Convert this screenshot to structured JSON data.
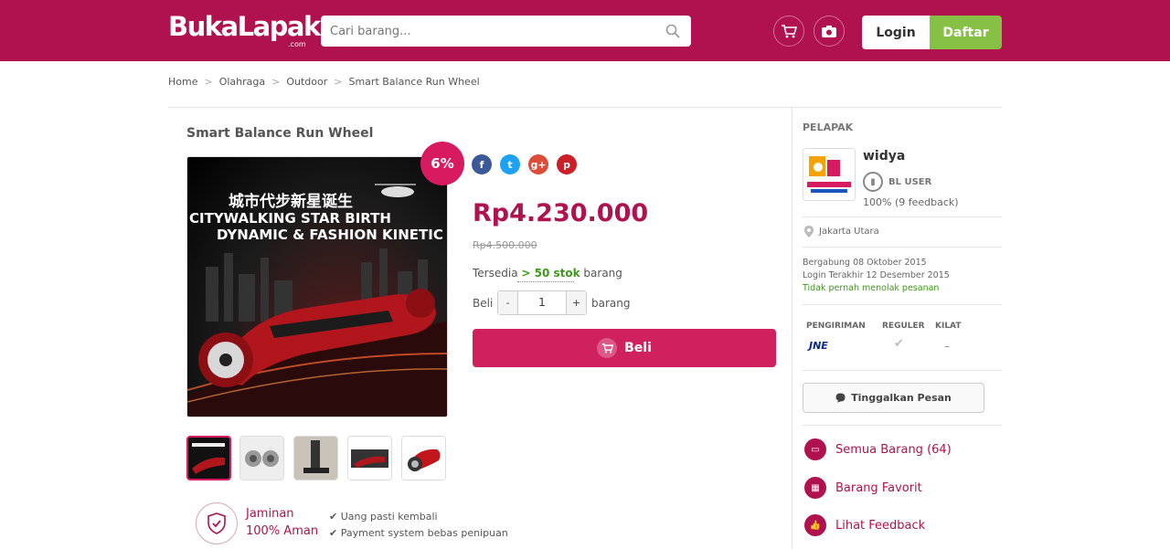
{
  "header": {
    "logo": "BukaLapak",
    "logo_sub": ".com",
    "search_placeholder": "Cari barang...",
    "login_label": "Login",
    "register_label": "Daftar",
    "icons": [
      "search-icon",
      "cart-icon",
      "camera-icon"
    ],
    "colors": {
      "brand": "#b0124f",
      "register": "#86c045"
    }
  },
  "breadcrumb": [
    "Home",
    "Olahraga",
    "Outdoor",
    "Smart Balance Run Wheel"
  ],
  "product": {
    "title": "Smart Balance Run Wheel",
    "discount": "6%",
    "image_text_line1": "城市代步新星诞生",
    "image_text_line2": "CITYWALKING STAR BIRTH",
    "image_text_line3": "DYNAMIC & FASHION KINETIC",
    "price": "Rp4.230.000",
    "old_price": "Rp4.500.000",
    "stock_label": "Tersedia",
    "stock_value": "> 50 stok",
    "stock_unit": "barang",
    "buy_label": "Beli",
    "qty_minus": "-",
    "qty_value": "1",
    "qty_plus": "+",
    "qty_unit": "barang",
    "buy_button": "Beli",
    "share_icons": [
      "facebook-icon",
      "twitter-icon",
      "google-plus-icon",
      "pinterest-icon"
    ],
    "thumbnail_count": 5
  },
  "guarantee": {
    "title_line1": "Jaminan",
    "title_line2": "100% Aman",
    "point1": "✔ Uang pasti kembali",
    "point2": "✔ Payment system bebas penipuan"
  },
  "seller": {
    "section_label": "PELAPAK",
    "name": "widya",
    "badge": "BL USER",
    "feedback": "100% (9 feedback)",
    "location": "Jakarta Utara",
    "joined": "Bergabung 08 Oktober 2015",
    "last_login": "Login Terakhir 12 Desember 2015",
    "never_reject": "Tidak pernah menolak pesanan",
    "shipping_header": "PENGIRIMAN",
    "shipping_col1": "REGULER",
    "shipping_col2": "KILAT",
    "courier": "JNE",
    "kilat_value": "–",
    "message_button": "Tinggalkan Pesan",
    "links": [
      "Semua Barang (64)",
      "Barang Favorit",
      "Lihat Feedback"
    ]
  }
}
